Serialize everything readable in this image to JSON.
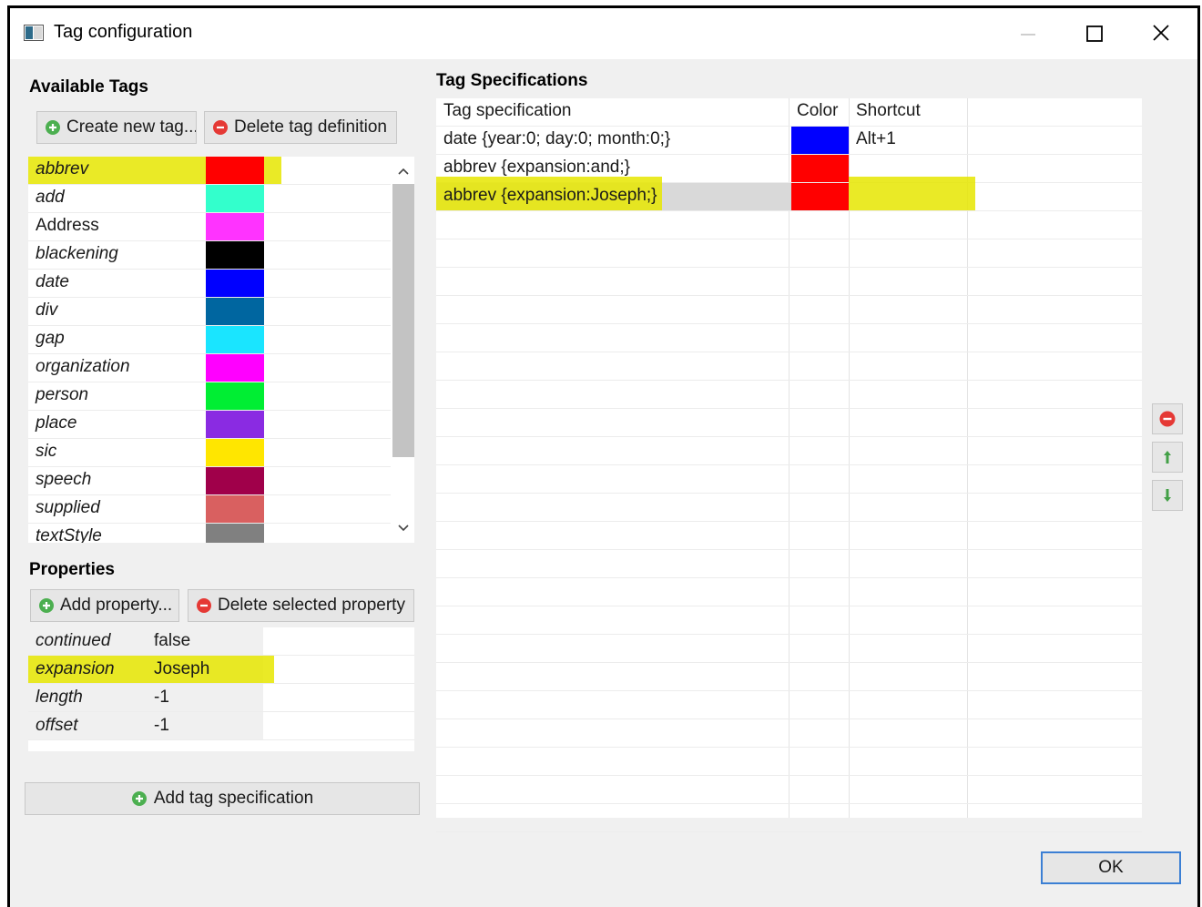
{
  "window": {
    "title": "Tag configuration"
  },
  "available_tags": {
    "heading": "Available Tags",
    "create_button": "Create new tag...",
    "delete_button": "Delete tag definition",
    "items": [
      {
        "name": "abbrev",
        "color": "#ff0000"
      },
      {
        "name": "add",
        "color": "#33ffcc"
      },
      {
        "name": "Address",
        "color": "#ff33ff"
      },
      {
        "name": "blackening",
        "color": "#000000"
      },
      {
        "name": "date",
        "color": "#0000ff"
      },
      {
        "name": "div",
        "color": "#0066a0"
      },
      {
        "name": "gap",
        "color": "#1ae5ff"
      },
      {
        "name": "organization",
        "color": "#ff00ff"
      },
      {
        "name": "person",
        "color": "#00ee33"
      },
      {
        "name": "place",
        "color": "#8a2be2"
      },
      {
        "name": "sic",
        "color": "#ffe600"
      },
      {
        "name": "speech",
        "color": "#a0004a"
      },
      {
        "name": "supplied",
        "color": "#d96060"
      },
      {
        "name": "textStyle",
        "color": "#808080"
      }
    ]
  },
  "properties": {
    "heading": "Properties",
    "add_button": "Add property...",
    "delete_button": "Delete selected property",
    "rows": [
      {
        "key": "continued",
        "value": "false"
      },
      {
        "key": "expansion",
        "value": "Joseph"
      },
      {
        "key": "length",
        "value": "-1"
      },
      {
        "key": "offset",
        "value": "-1"
      }
    ]
  },
  "add_spec_button": "Add tag specification",
  "tag_specifications": {
    "heading": "Tag Specifications",
    "columns": [
      "Tag specification",
      "Color",
      "Shortcut"
    ],
    "rows": [
      {
        "spec": "date {year:0; day:0; month:0;}",
        "color": "#0000ff",
        "shortcut": "Alt+1"
      },
      {
        "spec": "abbrev {expansion:and;}",
        "color": "#ff0000",
        "shortcut": ""
      },
      {
        "spec": "abbrev {expansion:Joseph;}",
        "color": "#ff0000",
        "shortcut": ""
      }
    ]
  },
  "ok_button": "OK",
  "colors": {
    "highlight": "#e6e600",
    "accent": "#3b7fd4"
  }
}
